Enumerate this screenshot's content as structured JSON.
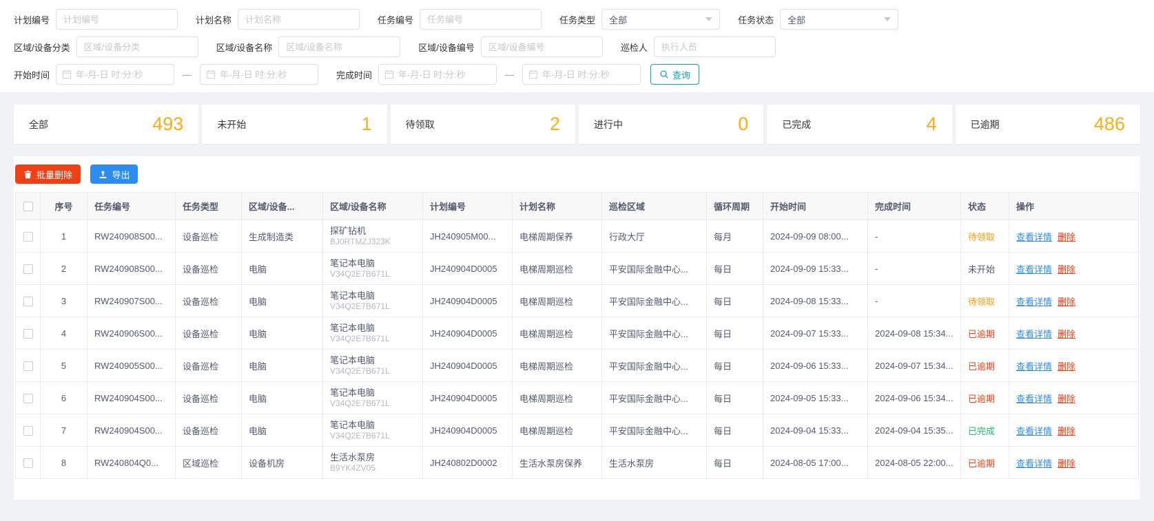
{
  "filters": {
    "plan_no": {
      "label": "计划编号",
      "placeholder": "计划编号"
    },
    "plan_name": {
      "label": "计划名称",
      "placeholder": "计划名称"
    },
    "task_no": {
      "label": "任务编号",
      "placeholder": "任务编号"
    },
    "task_type": {
      "label": "任务类型",
      "value": "全部"
    },
    "task_status": {
      "label": "任务状态",
      "value": "全部"
    },
    "device_cat": {
      "label": "区域/设备分类",
      "placeholder": "区域/设备分类"
    },
    "device_name": {
      "label": "区域/设备名称",
      "placeholder": "区域/设备名称"
    },
    "device_code": {
      "label": "区域/设备编号",
      "placeholder": "区域/设备编号"
    },
    "inspector": {
      "label": "巡检人",
      "placeholder": "执行人员"
    },
    "start_time": {
      "label": "开始时间",
      "placeholder": "年-月-日 时:分:秒"
    },
    "finish_time": {
      "label": "完成时间",
      "placeholder": "年-月-日 时:分:秒"
    },
    "range_separator": "—",
    "query_label": "查询"
  },
  "stats": [
    {
      "label": "全部",
      "value": "493"
    },
    {
      "label": "未开始",
      "value": "1"
    },
    {
      "label": "待领取",
      "value": "2"
    },
    {
      "label": "进行中",
      "value": "0"
    },
    {
      "label": "已完成",
      "value": "4"
    },
    {
      "label": "已逾期",
      "value": "486"
    }
  ],
  "toolbar": {
    "batch_delete": "批量删除",
    "export": "导出"
  },
  "table": {
    "headers": [
      "序号",
      "任务编号",
      "任务类型",
      "区域/设备...",
      "区域/设备名称",
      "计划编号",
      "计划名称",
      "巡检区域",
      "循环周期",
      "开始时间",
      "完成时间",
      "状态",
      "操作"
    ],
    "actions": {
      "view": "查看详情",
      "delete": "删除"
    },
    "rows": [
      {
        "index": "1",
        "task_no": "RW240908S00...",
        "task_type": "设备巡检",
        "device_cat": "生成制造类",
        "device_name": "探矿钻机",
        "device_code": "BJ0RTMZJ323K",
        "plan_no": "JH240905M00...",
        "plan_name": "电梯周期保养",
        "area": "行政大厅",
        "cycle": "每月",
        "start": "2024-09-09 08:00...",
        "finish": "-",
        "status": "待领取"
      },
      {
        "index": "2",
        "task_no": "RW240908S00...",
        "task_type": "设备巡检",
        "device_cat": "电脑",
        "device_name": "笔记本电脑",
        "device_code": "V34Q2E7B671L",
        "plan_no": "JH240904D0005",
        "plan_name": "电梯周期巡检",
        "area": "平安国际金融中心...",
        "cycle": "每日",
        "start": "2024-09-09 15:33...",
        "finish": "-",
        "status": "未开始"
      },
      {
        "index": "3",
        "task_no": "RW240907S00...",
        "task_type": "设备巡检",
        "device_cat": "电脑",
        "device_name": "笔记本电脑",
        "device_code": "V34Q2E7B671L",
        "plan_no": "JH240904D0005",
        "plan_name": "电梯周期巡检",
        "area": "平安国际金融中心...",
        "cycle": "每日",
        "start": "2024-09-08 15:33...",
        "finish": "-",
        "status": "待领取"
      },
      {
        "index": "4",
        "task_no": "RW240906S00...",
        "task_type": "设备巡检",
        "device_cat": "电脑",
        "device_name": "笔记本电脑",
        "device_code": "V34Q2E7B671L",
        "plan_no": "JH240904D0005",
        "plan_name": "电梯周期巡检",
        "area": "平安国际金融中心...",
        "cycle": "每日",
        "start": "2024-09-07 15:33...",
        "finish": "2024-09-08 15:34...",
        "status": "已逾期"
      },
      {
        "index": "5",
        "task_no": "RW240905S00...",
        "task_type": "设备巡检",
        "device_cat": "电脑",
        "device_name": "笔记本电脑",
        "device_code": "V34Q2E7B671L",
        "plan_no": "JH240904D0005",
        "plan_name": "电梯周期巡检",
        "area": "平安国际金融中心...",
        "cycle": "每日",
        "start": "2024-09-06 15:33...",
        "finish": "2024-09-07 15:34...",
        "status": "已逾期"
      },
      {
        "index": "6",
        "task_no": "RW240904S00...",
        "task_type": "设备巡检",
        "device_cat": "电脑",
        "device_name": "笔记本电脑",
        "device_code": "V34Q2E7B671L",
        "plan_no": "JH240904D0005",
        "plan_name": "电梯周期巡检",
        "area": "平安国际金融中心...",
        "cycle": "每日",
        "start": "2024-09-05 15:33...",
        "finish": "2024-09-06 15:34...",
        "status": "已逾期"
      },
      {
        "index": "7",
        "task_no": "RW240904S00...",
        "task_type": "设备巡检",
        "device_cat": "电脑",
        "device_name": "笔记本电脑",
        "device_code": "V34Q2E7B671L",
        "plan_no": "JH240904D0005",
        "plan_name": "电梯周期巡检",
        "area": "平安国际金融中心...",
        "cycle": "每日",
        "start": "2024-09-04 15:33...",
        "finish": "2024-09-04 15:35...",
        "status": "已完成"
      },
      {
        "index": "8",
        "task_no": "RW240804Q0...",
        "task_type": "区域巡检",
        "device_cat": "设备机房",
        "device_name": "生活水泵房",
        "device_code": "B9YK4ZV05",
        "plan_no": "JH240802D0002",
        "plan_name": "生活水泵房保养",
        "area": "生活水泵房",
        "cycle": "每日",
        "start": "2024-08-05 17:00...",
        "finish": "2024-08-05 22:00...",
        "status": "已逾期"
      }
    ]
  },
  "status_colors": {
    "待领取": "#ff9900",
    "未开始": "#515a6e",
    "已逾期": "#ed4014",
    "已完成": "#19be6b"
  },
  "colors": {
    "stat_number": "#faad14",
    "query_teal": "#14a5a5",
    "danger_red": "#ed4014",
    "primary_blue": "#2d8cf0"
  }
}
